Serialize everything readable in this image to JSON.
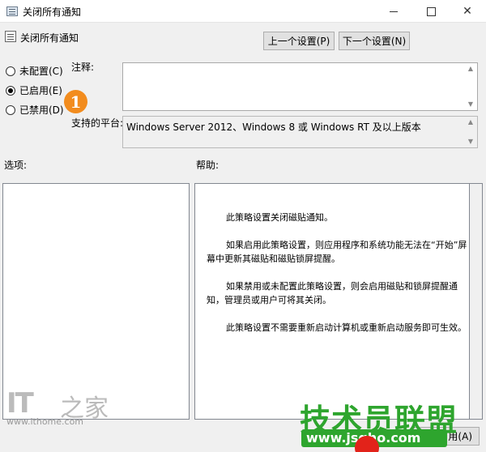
{
  "window": {
    "title": "关闭所有通知",
    "minimize_icon": "minimize-icon",
    "maximize_icon": "maximize-icon",
    "close_glyph": "✕"
  },
  "header": {
    "policy_name": "关闭所有通知",
    "prev_button": "上一个设置(P)",
    "next_button": "下一个设置(N)"
  },
  "state": {
    "options": [
      {
        "label": "未配置(C)",
        "checked": false
      },
      {
        "label": "已启用(E)",
        "checked": true
      },
      {
        "label": "已禁用(D)",
        "checked": false
      }
    ],
    "step_badge": "1"
  },
  "comment": {
    "label": "注释:",
    "value": ""
  },
  "platform": {
    "label": "支持的平台:",
    "value": "Windows Server 2012、Windows 8 或 Windows RT 及以上版本"
  },
  "options_pane": {
    "label": "选项:"
  },
  "help_pane": {
    "label": "帮助:",
    "paragraphs": [
      "此策略设置关闭磁贴通知。",
      "如果启用此策略设置，则应用程序和系统功能无法在“开始”屏幕中更新其磁贴和磁贴锁屏提醒。",
      "如果禁用或未配置此策略设置，则会启用磁贴和锁屏提醒通知，管理员或用户可将其关闭。",
      "此策略设置不需要重新启动计算机或重新启动服务即可生效。"
    ]
  },
  "footer": {
    "apply_partial": "用(A)"
  },
  "watermarks": {
    "ithome_logo": "IT",
    "ithome_logo_cn": "之家",
    "ithome_url": "www.ithome.com",
    "site_title": "技术员联盟",
    "site_url": "www.jsgho.com",
    "accent_green": "#2ea52e",
    "badge_orange": "#f28c1e"
  }
}
